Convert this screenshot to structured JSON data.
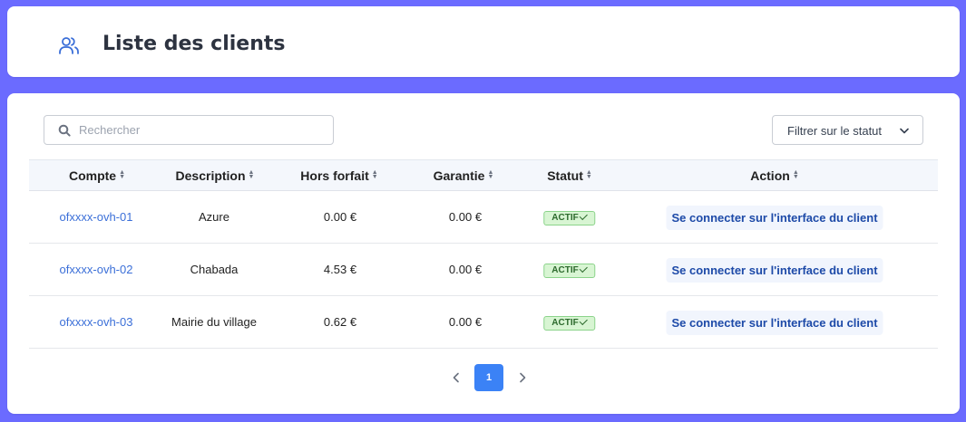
{
  "header": {
    "title": "Liste des clients",
    "icon": "users-icon"
  },
  "toolbar": {
    "search_placeholder": "Rechercher",
    "filter_label": "Filtrer sur le statut"
  },
  "table": {
    "columns": [
      "Compte",
      "Description",
      "Hors forfait",
      "Garantie",
      "Statut",
      "Action"
    ],
    "rows": [
      {
        "compte": "ofxxxx-ovh-01",
        "description": "Azure",
        "hors_forfait": "0.00 €",
        "garantie": "0.00 €",
        "statut": "ACTIF",
        "action": "Se connecter sur l'interface du client"
      },
      {
        "compte": "ofxxxx-ovh-02",
        "description": "Chabada",
        "hors_forfait": "4.53 €",
        "garantie": "0.00 €",
        "statut": "ACTIF",
        "action": "Se connecter sur l'interface du client"
      },
      {
        "compte": "ofxxxx-ovh-03",
        "description": "Mairie du village",
        "hors_forfait": "0.62 €",
        "garantie": "0.00 €",
        "statut": "ACTIF",
        "action": "Se connecter sur l'interface du client"
      }
    ]
  },
  "pagination": {
    "current_page": "1"
  },
  "colors": {
    "background": "#6b6bff",
    "accent": "#3b82f6",
    "link": "#3b6fd8",
    "status_bg": "#d8f5d3"
  }
}
